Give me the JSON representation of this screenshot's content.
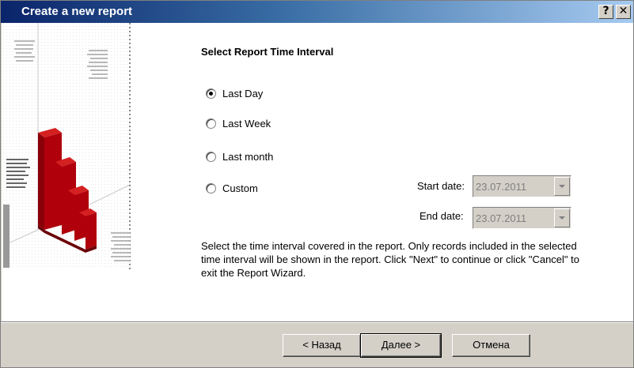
{
  "window": {
    "title": "Create a new report",
    "help_button": "?",
    "close_button": "✕"
  },
  "main": {
    "heading": "Select Report Time Interval",
    "options": [
      {
        "label": "Last Day",
        "checked": true
      },
      {
        "label": "Last Week",
        "checked": false
      },
      {
        "label": "Last month",
        "checked": false
      },
      {
        "label": "Custom",
        "checked": false
      }
    ],
    "start_date_label": "Start date:",
    "start_date_value": "23.07.2011",
    "end_date_label": "End date:",
    "end_date_value": "23.07.2011",
    "description": "Select the time interval covered in the report. Only records included in the selected time interval will be shown in the report. Click \"Next\" to continue or click \"Cancel\" to exit the Report Wizard."
  },
  "footer": {
    "back_label": "< Назад",
    "next_label": "Далее >",
    "cancel_label": "Отмена"
  },
  "colors": {
    "titlebar_start": "#0a246a",
    "titlebar_end": "#a6caf0",
    "chart_red": "#b0000c"
  }
}
